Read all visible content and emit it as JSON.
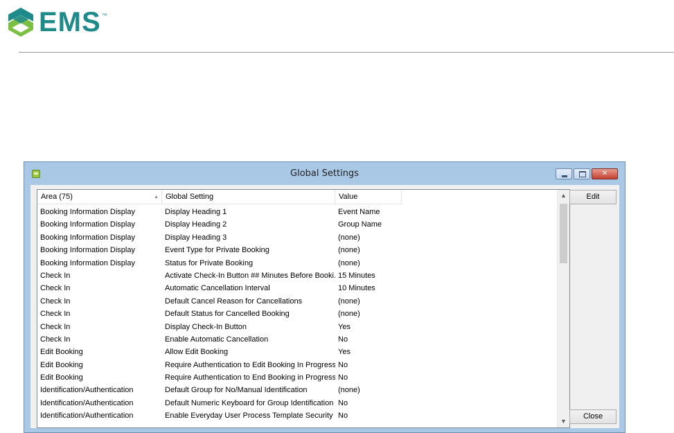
{
  "brand": {
    "name": "EMS",
    "tm": "™",
    "colors": {
      "primary": "#1f8a8a",
      "accent": "#7cc043"
    }
  },
  "window": {
    "title": "Global Settings",
    "icon": "app-icon",
    "caption_buttons": [
      "minimize-icon",
      "maximize-icon",
      "close-icon"
    ]
  },
  "list": {
    "columns": [
      {
        "label": "Area (75)",
        "sorted": "ascending"
      },
      {
        "label": "Global Setting"
      },
      {
        "label": "Value"
      }
    ],
    "rows": [
      {
        "area": "Booking Information Display",
        "setting": "Display Heading 1",
        "value": "Event Name"
      },
      {
        "area": "Booking Information Display",
        "setting": "Display Heading 2",
        "value": "Group Name"
      },
      {
        "area": "Booking Information Display",
        "setting": "Display Heading 3",
        "value": "(none)"
      },
      {
        "area": "Booking Information Display",
        "setting": "Event Type for Private Booking",
        "value": "(none)"
      },
      {
        "area": "Booking Information Display",
        "setting": "Status for Private Booking",
        "value": "(none)"
      },
      {
        "area": "Check In",
        "setting": "Activate Check-In Button ## Minutes Before Booki...",
        "value": "15 Minutes"
      },
      {
        "area": "Check In",
        "setting": "Automatic Cancellation Interval",
        "value": "10 Minutes"
      },
      {
        "area": "Check In",
        "setting": "Default Cancel Reason for Cancellations",
        "value": "(none)"
      },
      {
        "area": "Check In",
        "setting": "Default Status for Cancelled Booking",
        "value": "(none)"
      },
      {
        "area": "Check In",
        "setting": "Display Check-In Button",
        "value": "Yes"
      },
      {
        "area": "Check In",
        "setting": "Enable Automatic Cancellation",
        "value": "No"
      },
      {
        "area": "Edit Booking",
        "setting": "Allow Edit Booking",
        "value": "Yes"
      },
      {
        "area": "Edit Booking",
        "setting": "Require Authentication to Edit Booking In Progress",
        "value": "No"
      },
      {
        "area": "Edit Booking",
        "setting": "Require Authentication to End Booking in Progress",
        "value": "No"
      },
      {
        "area": "Identification/Authentication",
        "setting": "Default Group for No/Manual Identification",
        "value": "(none)"
      },
      {
        "area": "Identification/Authentication",
        "setting": "Default Numeric Keyboard for Group Identification",
        "value": "No"
      },
      {
        "area": "Identification/Authentication",
        "setting": "Enable Everyday User Process Template Security",
        "value": "No"
      }
    ]
  },
  "buttons": {
    "edit": "Edit",
    "close": "Close"
  },
  "scrollbar": {
    "up_icon": "chevron-up-icon",
    "down_icon": "chevron-down-icon"
  }
}
